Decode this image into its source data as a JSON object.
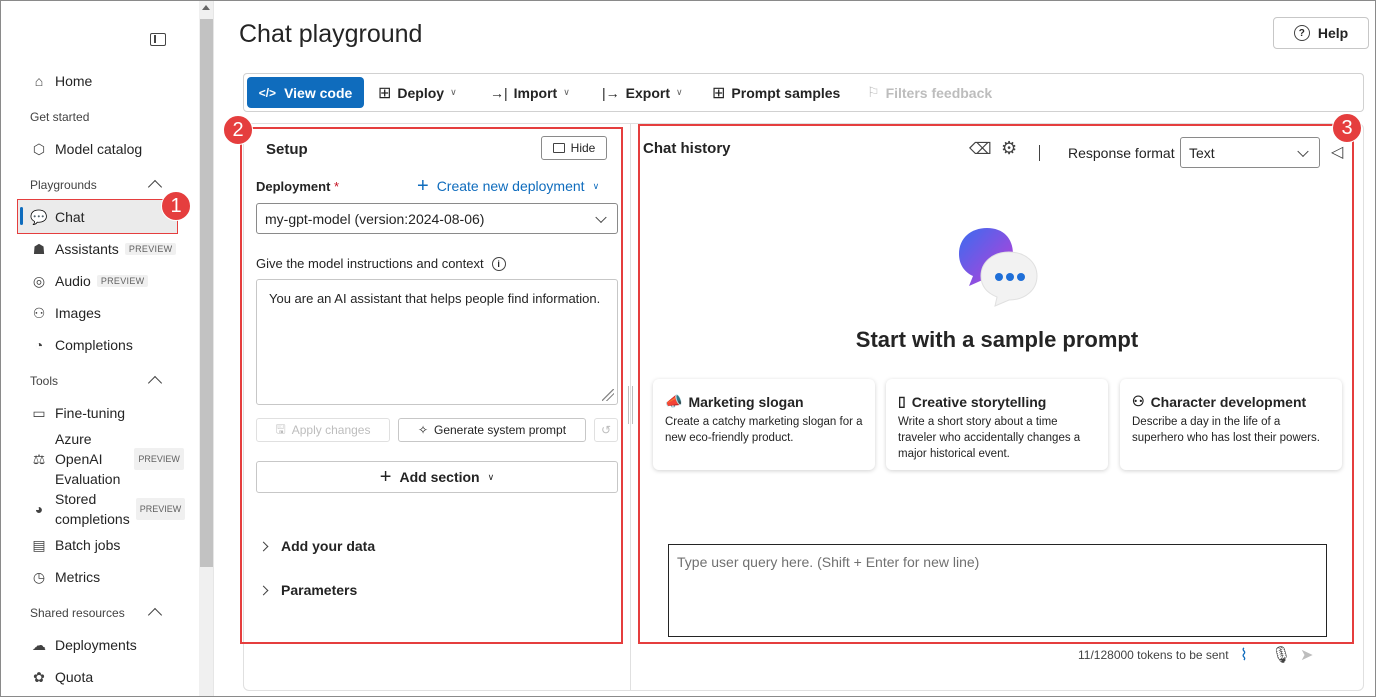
{
  "sidebar": {
    "home": "Home",
    "get_started": "Get started",
    "model_catalog": "Model catalog",
    "playgrounds": "Playgrounds",
    "chat": "Chat",
    "assistants": "Assistants",
    "audio": "Audio",
    "images": "Images",
    "completions": "Completions",
    "tools": "Tools",
    "fine_tuning": "Fine-tuning",
    "azure_eval_1": "Azure",
    "azure_eval_2": "OpenAI",
    "azure_eval_3": "Evaluation",
    "stored_1": "Stored",
    "stored_2": "completions",
    "batch_jobs": "Batch jobs",
    "metrics": "Metrics",
    "shared_resources": "Shared resources",
    "deployments": "Deployments",
    "quota": "Quota",
    "preview_badge": "PREVIEW"
  },
  "markers": {
    "one": "1",
    "two": "2",
    "three": "3"
  },
  "page": {
    "title": "Chat playground",
    "help": "Help"
  },
  "toolbar": {
    "view_code": "View code",
    "deploy": "Deploy",
    "import": "Import",
    "export": "Export",
    "prompt_samples": "Prompt samples",
    "filters_feedback": "Filters feedback"
  },
  "setup": {
    "title": "Setup",
    "hide": "Hide",
    "deployment_label": "Deployment",
    "required_mark": "*",
    "create_deployment": "Create new deployment",
    "deployment_value": "my-gpt-model (version:2024-08-06)",
    "instructions_label": "Give the model instructions and context",
    "instructions_text": "You are an AI assistant that helps people find information.",
    "apply_changes": "Apply changes",
    "generate_prompt": "Generate system prompt",
    "add_section": "Add section",
    "add_data": "Add your data",
    "parameters": "Parameters"
  },
  "chat": {
    "title": "Chat history",
    "response_format_label": "Response format",
    "response_format_value": "Text",
    "start_heading": "Start with a sample prompt",
    "cards": [
      {
        "title": "Marketing slogan",
        "desc": "Create a catchy marketing slogan for a new eco-friendly product."
      },
      {
        "title": "Creative storytelling",
        "desc": "Write a short story about a time traveler who accidentally changes a major historical event."
      },
      {
        "title": "Character development",
        "desc": "Describe a day in the life of a superhero who has lost their powers."
      }
    ],
    "query_placeholder": "Type user query here. (Shift + Enter for new line)",
    "tokens": "11/128000 tokens to be sent"
  },
  "colors": {
    "accent": "#0f6cbd",
    "highlight": "#e53e3e"
  }
}
